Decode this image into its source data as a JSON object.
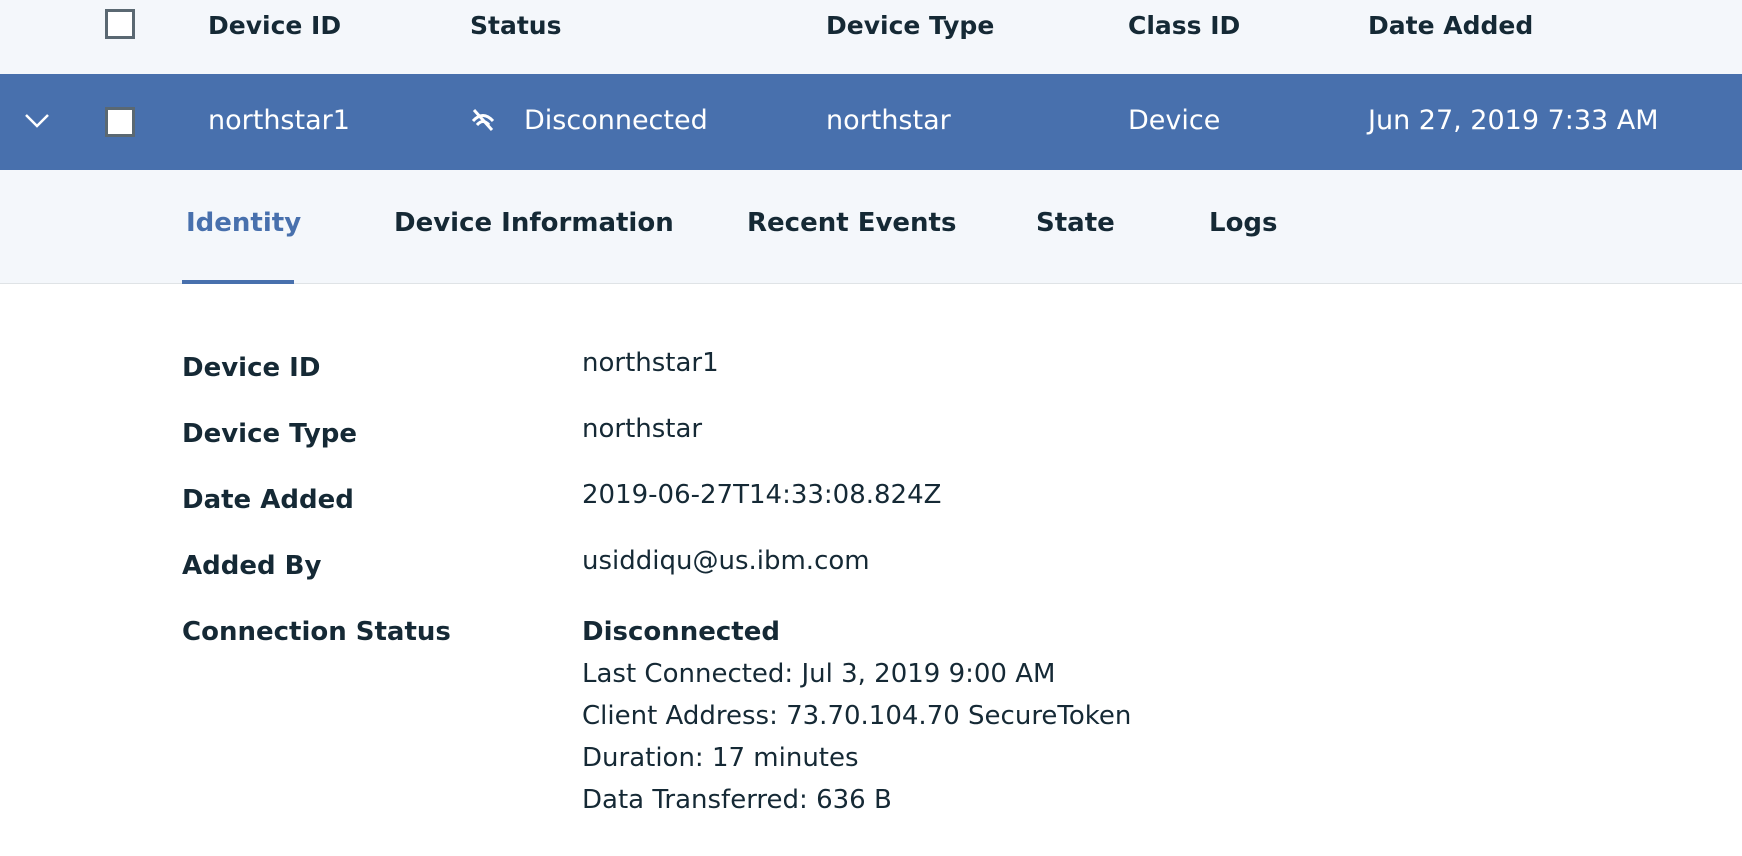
{
  "table": {
    "headers": {
      "device_id": "Device ID",
      "status": "Status",
      "device_type": "Device Type",
      "class_id": "Class ID",
      "date_added": "Date Added"
    },
    "row": {
      "device_id": "northstar1",
      "status": "Disconnected",
      "device_type": "northstar",
      "class_id": "Device",
      "date_added": "Jun 27, 2019 7:33 AM"
    }
  },
  "tabs": [
    {
      "label": "Identity",
      "active": true
    },
    {
      "label": "Device Information",
      "active": false
    },
    {
      "label": "Recent Events",
      "active": false
    },
    {
      "label": "State",
      "active": false
    },
    {
      "label": "Logs",
      "active": false
    }
  ],
  "identity": {
    "device_id_label": "Device ID",
    "device_id": "northstar1",
    "device_type_label": "Device Type",
    "device_type": "northstar",
    "date_added_label": "Date Added",
    "date_added": "2019-06-27T14:33:08.824Z",
    "added_by_label": "Added By",
    "added_by": "usiddiqu@us.ibm.com",
    "connection_status_label": "Connection Status",
    "connection_status": "Disconnected",
    "last_connected": "Last Connected: Jul 3, 2019 9:00 AM",
    "client_address": "Client Address: 73.70.104.70 SecureToken",
    "duration": "Duration: 17 minutes",
    "data_transferred": "Data Transferred: 636 B"
  },
  "icons": {
    "expand": "chevron-down-icon",
    "status": "disconnected-icon"
  },
  "colors": {
    "accent": "#4870ad",
    "header_bg": "#f4f7fb",
    "text": "#152935"
  }
}
